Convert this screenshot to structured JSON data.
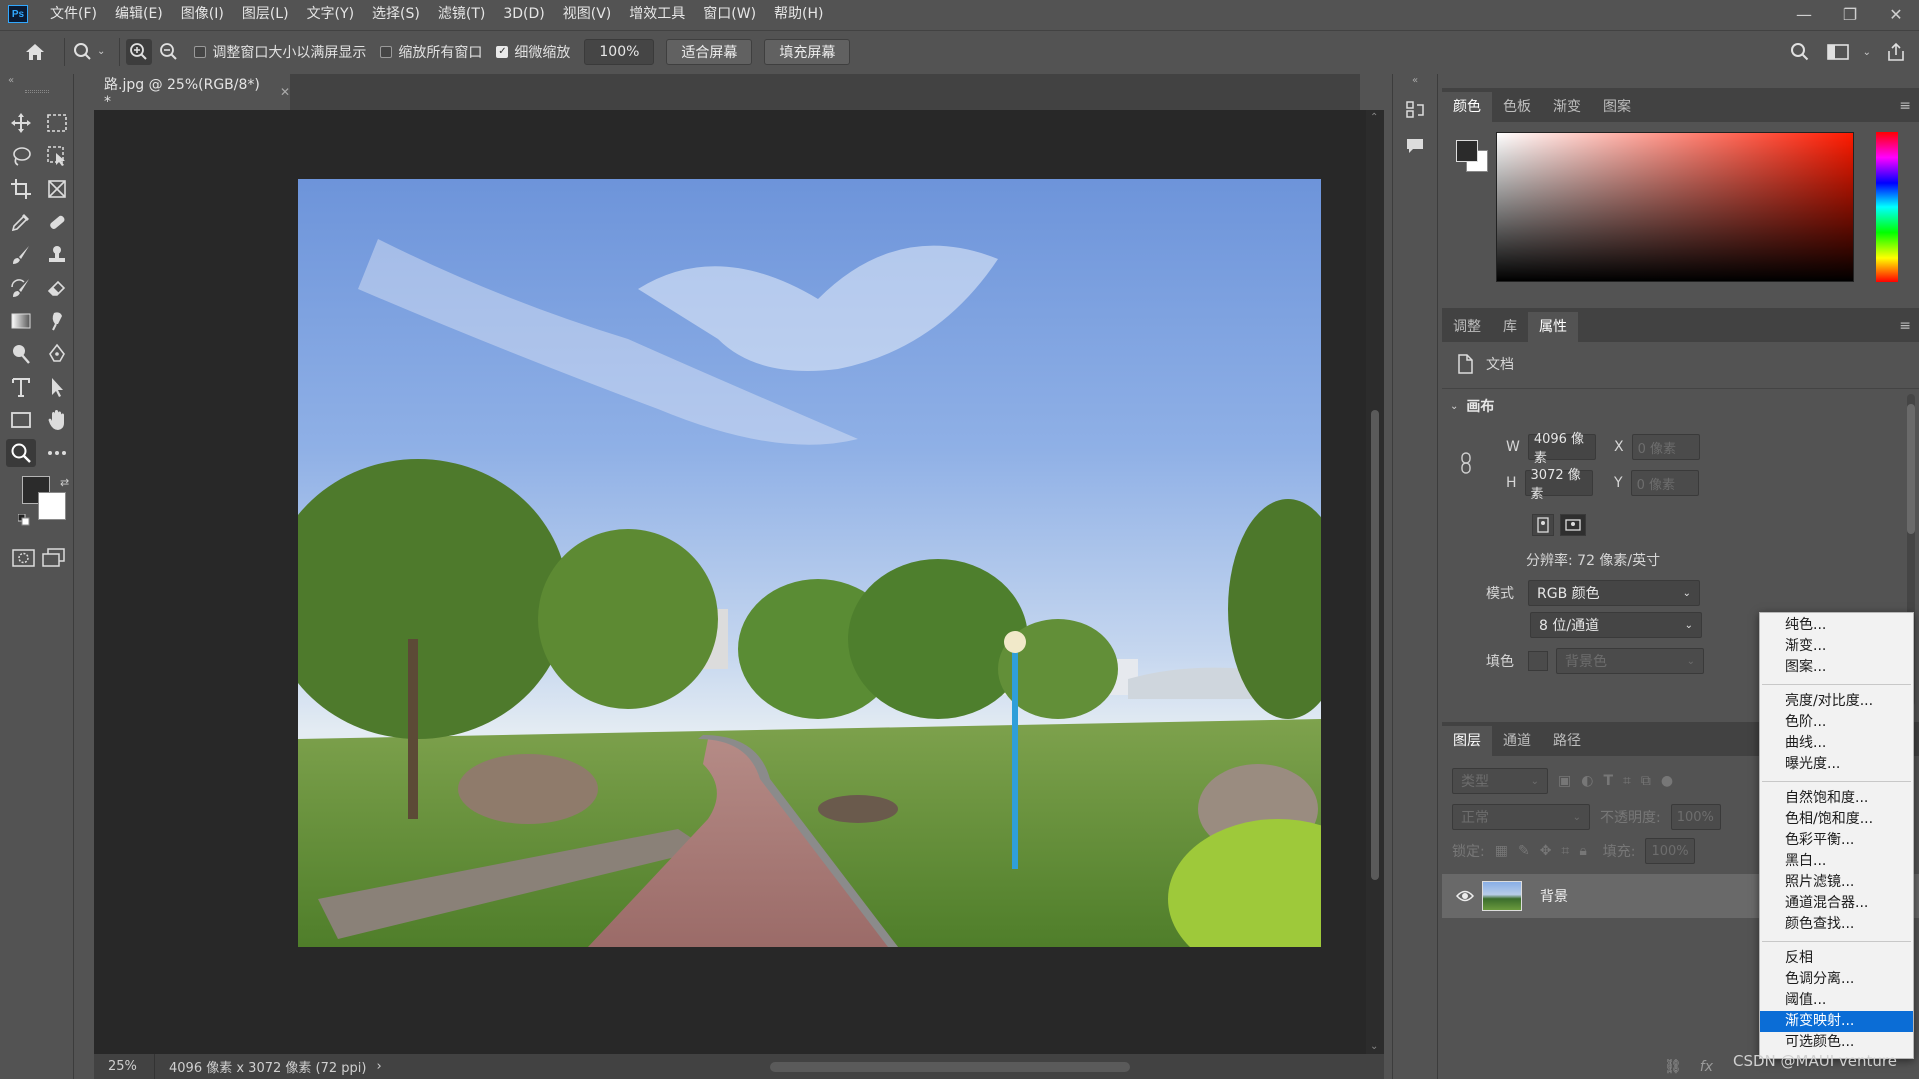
{
  "app": {
    "logo": "Ps"
  },
  "menu": [
    "文件(F)",
    "编辑(E)",
    "图像(I)",
    "图层(L)",
    "文字(Y)",
    "选择(S)",
    "滤镜(T)",
    "3D(D)",
    "视图(V)",
    "增效工具",
    "窗口(W)",
    "帮助(H)"
  ],
  "window_controls": {
    "minimize": "—",
    "restore": "❐",
    "close": "✕"
  },
  "options": {
    "resize_windows": "调整窗口大小以满屏显示",
    "zoom_all": "缩放所有窗口",
    "scrubby_zoom": "细微缩放",
    "scrubby_checked": true,
    "zoom_value": "100%",
    "fit_screen": "适合屏幕",
    "fill_screen": "填充屏幕"
  },
  "document": {
    "tab_title": "路.jpg @ 25%(RGB/8*) *",
    "zoom": "25%",
    "status_info": "4096 像素 x 3072 像素 (72 ppi)"
  },
  "color_panel": {
    "tabs": [
      "颜色",
      "色板",
      "渐变",
      "图案"
    ],
    "active": 0,
    "fg_color": "#2b2b2b",
    "bg_color": "#ffffff"
  },
  "properties_panel": {
    "tabs": [
      "调整",
      "库",
      "属性"
    ],
    "active": 2,
    "doc_label": "文档",
    "canvas_section": "画布",
    "w_label": "W",
    "w_value": "4096 像素",
    "h_label": "H",
    "h_value": "3072 像素",
    "x_label": "X",
    "x_value": "0 像素",
    "y_label": "Y",
    "y_value": "0 像素",
    "resolution": "分辨率: 72 像素/英寸",
    "mode_label": "模式",
    "mode_value": "RGB 颜色",
    "depth_value": "8 位/通道",
    "fill_label": "填色",
    "fill_value": "背景色"
  },
  "layers_panel": {
    "tabs": [
      "图层",
      "通道",
      "路径"
    ],
    "active": 0,
    "filter_placeholder": "类型",
    "blend_mode": "正常",
    "opacity_label": "不透明度:",
    "opacity_value": "100%",
    "lock_label": "锁定:",
    "fill_label": "填充:",
    "fill_value": "100%",
    "layer_name": "背景"
  },
  "adjustment_menu": {
    "groups": [
      [
        "纯色...",
        "渐变...",
        "图案..."
      ],
      [
        "亮度/对比度...",
        "色阶...",
        "曲线...",
        "曝光度..."
      ],
      [
        "自然饱和度...",
        "色相/饱和度...",
        "色彩平衡...",
        "黑白...",
        "照片滤镜...",
        "通道混合器...",
        "颜色查找..."
      ],
      [
        "反相",
        "色调分离...",
        "阈值...",
        "渐变映射...",
        "可选颜色..."
      ]
    ],
    "selected": "渐变映射..."
  },
  "watermark": "CSDN @MAUI venture"
}
